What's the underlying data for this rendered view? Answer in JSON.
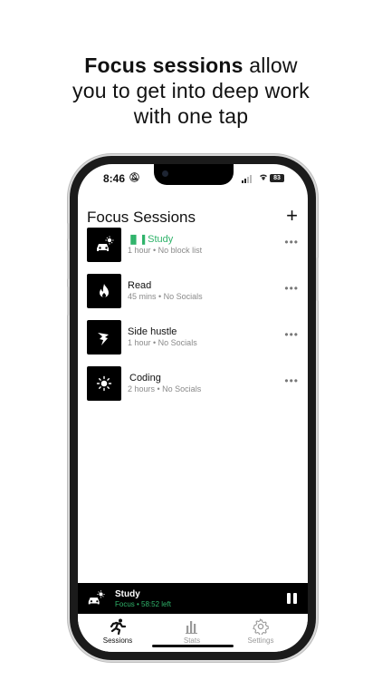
{
  "headline": {
    "bold": "Focus sessions",
    "rest1": " allow",
    "line2": "you to get into deep work",
    "line3": "with one tap"
  },
  "status_bar": {
    "time": "8:46",
    "battery": "83"
  },
  "screen": {
    "title": "Focus Sessions",
    "add_icon": "plus-icon"
  },
  "sessions": [
    {
      "name": "Study",
      "meta": "1 hour • No block list",
      "icon": "study-icon",
      "active": true,
      "active_color": "#2fb36a"
    },
    {
      "name": "Read",
      "meta": "45 mins • No Socials",
      "icon": "flame-icon",
      "active": false
    },
    {
      "name": "Side hustle",
      "meta": "1 hour • No Socials",
      "icon": "bolt-icon",
      "active": false
    },
    {
      "name": "Coding",
      "meta": "2 hours • No Socials",
      "icon": "sun-icon",
      "active": false
    }
  ],
  "now_playing": {
    "title": "Study",
    "subtitle": "Focus • 58:52 left"
  },
  "tabs": [
    {
      "label": "Sessions",
      "icon": "runner-icon",
      "selected": true
    },
    {
      "label": "Stats",
      "icon": "bar-chart-icon",
      "selected": false
    },
    {
      "label": "Settings",
      "icon": "gear-icon",
      "selected": false
    }
  ]
}
